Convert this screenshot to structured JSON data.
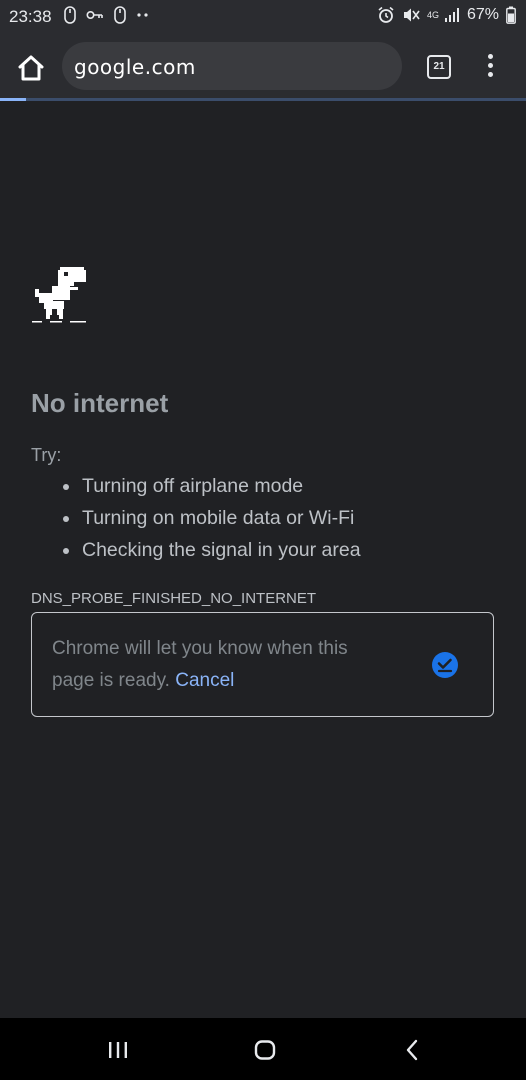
{
  "status_bar": {
    "time": "23:38",
    "network": "4G",
    "battery": "67%"
  },
  "toolbar": {
    "url": "google.com",
    "tab_count": "21",
    "page_load_progress": 0.05
  },
  "error_page": {
    "title": "No internet",
    "try_label": "Try:",
    "suggestions": [
      "Turning off airplane mode",
      "Turning on mobile data or Wi-Fi",
      "Checking the signal in your area"
    ],
    "error_code": "DNS_PROBE_FINISHED_NO_INTERNET",
    "notify_message": "Chrome will let you know when this page is ready.",
    "cancel_label": "Cancel"
  },
  "colors": {
    "background": "#202124",
    "toolbar": "#2b2c30",
    "accent_blue": "#8ab4f8",
    "check_blue": "#1a73e8"
  }
}
